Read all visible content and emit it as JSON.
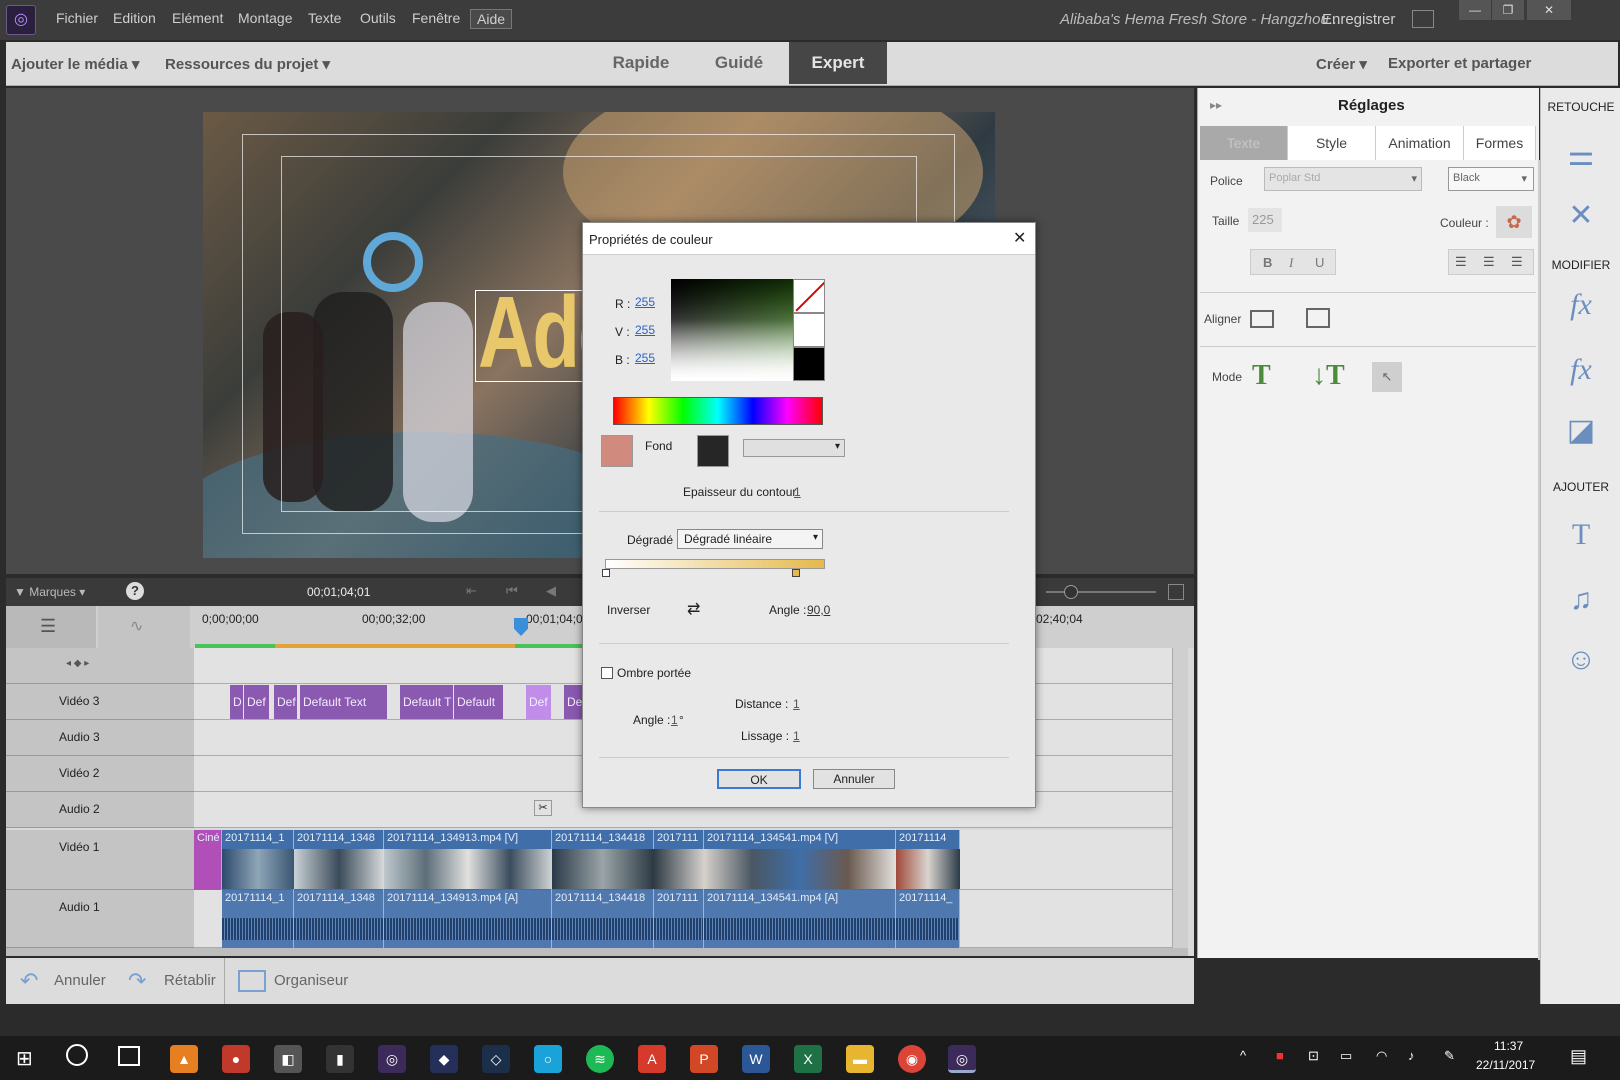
{
  "menubar": {
    "items": [
      "Fichier",
      "Edition",
      "Elément",
      "Montage",
      "Texte",
      "Outils",
      "Fenêtre",
      "Aide"
    ],
    "document_title": "Alibaba's Hema Fresh Store - Hangzhou...",
    "save_label": "Enregistrer"
  },
  "toolbar": {
    "add_media": "Ajouter le média",
    "project_assets": "Ressources du projet",
    "modes": [
      "Rapide",
      "Guidé",
      "Expert"
    ],
    "active_mode": "Expert",
    "create": "Créer",
    "export": "Exporter et partager"
  },
  "preview": {
    "overlay_text": "Add"
  },
  "timeline": {
    "markers_label": "Marques",
    "timecode": "00;01;04;01",
    "ruler": [
      "0;00;00;00",
      "00;00;32;00",
      "00;01;04;0",
      "02;40;04"
    ],
    "tracks": [
      {
        "name": "Vidéo 3",
        "type": "text",
        "clips": [
          "D",
          "Def",
          "Def",
          "Default Text",
          "Default T",
          "Default",
          "Def",
          "De"
        ]
      },
      {
        "name": "Audio 3",
        "type": "empty"
      },
      {
        "name": "Vidéo 2",
        "type": "empty"
      },
      {
        "name": "Audio 2",
        "type": "empty"
      },
      {
        "name": "Vidéo 1",
        "type": "video",
        "clips": [
          "Ciné",
          "20171114_1",
          "20171114_1348",
          "20171114_134913.mp4 [V]",
          "20171114_134418",
          "2017111",
          "20171114_134541.mp4 [V]",
          "20171114"
        ]
      },
      {
        "name": "Audio 1",
        "type": "audio",
        "clips": [
          "20171114_1",
          "20171114_1348",
          "20171114_134913.mp4 [A]",
          "20171114_134418",
          "2017111",
          "20171114_134541.mp4 [A]",
          "20171114_"
        ]
      }
    ]
  },
  "bottom_bar": {
    "undo": "Annuler",
    "redo": "Rétablir",
    "organizer": "Organiseur"
  },
  "right_panel": {
    "title": "Réglages",
    "tabs": [
      "Texte",
      "Style",
      "Animation",
      "Formes"
    ],
    "font_label": "Police",
    "font_value": "Poplar Std",
    "weight_value": "Black",
    "size_label": "Taille",
    "size_value": "225",
    "color_label": "Couleur :",
    "bold": "B",
    "italic": "I",
    "underline": "U",
    "align_label": "Aligner",
    "mode_label": "Mode"
  },
  "right_strip": {
    "retouche": "RETOUCHE",
    "modifier": "MODIFIER",
    "ajouter": "AJOUTER"
  },
  "dialog": {
    "title": "Propriétés de couleur",
    "r_label": "R :",
    "r_value": "255",
    "v_label": "V :",
    "v_value": "255",
    "b_label": "B :",
    "b_value": "255",
    "fond_label": "Fond",
    "stroke_label": "Epaisseur du contour",
    "stroke_value": "1",
    "gradient_label": "Dégradé",
    "gradient_value": "Dégradé linéaire",
    "invert_label": "Inverser",
    "angle_label": "Angle :",
    "angle_value": "90,0",
    "shadow_label": "Ombre portée",
    "shadow_angle_label": "Angle :",
    "shadow_angle_value": "1",
    "shadow_angle_unit": "°",
    "distance_label": "Distance :",
    "distance_value": "1",
    "smooth_label": "Lissage :",
    "smooth_value": "1",
    "ok": "OK",
    "cancel": "Annuler",
    "swatch_color": "#d08a7e",
    "fond_color": "#262626"
  },
  "taskbar": {
    "time": "11:37",
    "date": "22/11/2017"
  }
}
